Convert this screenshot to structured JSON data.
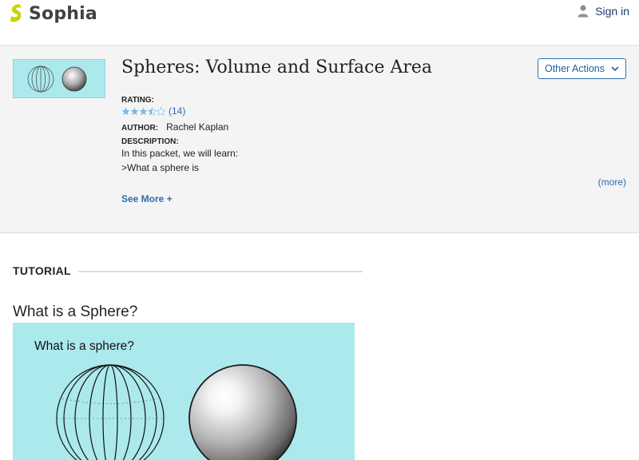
{
  "header": {
    "brand": "Sophia",
    "brand_color": "#c8d400",
    "signin_label": "Sign in",
    "signin_icon": "user-icon"
  },
  "resource": {
    "title": "Spheres: Volume and Surface Area",
    "other_actions_label": "Other Actions",
    "rating_label": "RATING:",
    "rating_value": 3.5,
    "rating_max": 5,
    "rating_count": "(14)",
    "author_label": "AUTHOR:",
    "author_name": "Rachel Kaplan",
    "description_label": "DESCRIPTION:",
    "description_lines": [
      "In this packet, we will learn:",
      ">What a sphere is"
    ],
    "more_label": "(more)",
    "see_more_label": "See More +"
  },
  "tutorial": {
    "section_label": "TUTORIAL",
    "heading": "What is a Sphere?",
    "figure_caption": "What is a sphere?",
    "figure_bg": "#abe9ec"
  },
  "colors": {
    "accent_blue": "#2b6cb0",
    "band_bg": "#f4f4f4",
    "star_fill": "#7ab8e6"
  }
}
